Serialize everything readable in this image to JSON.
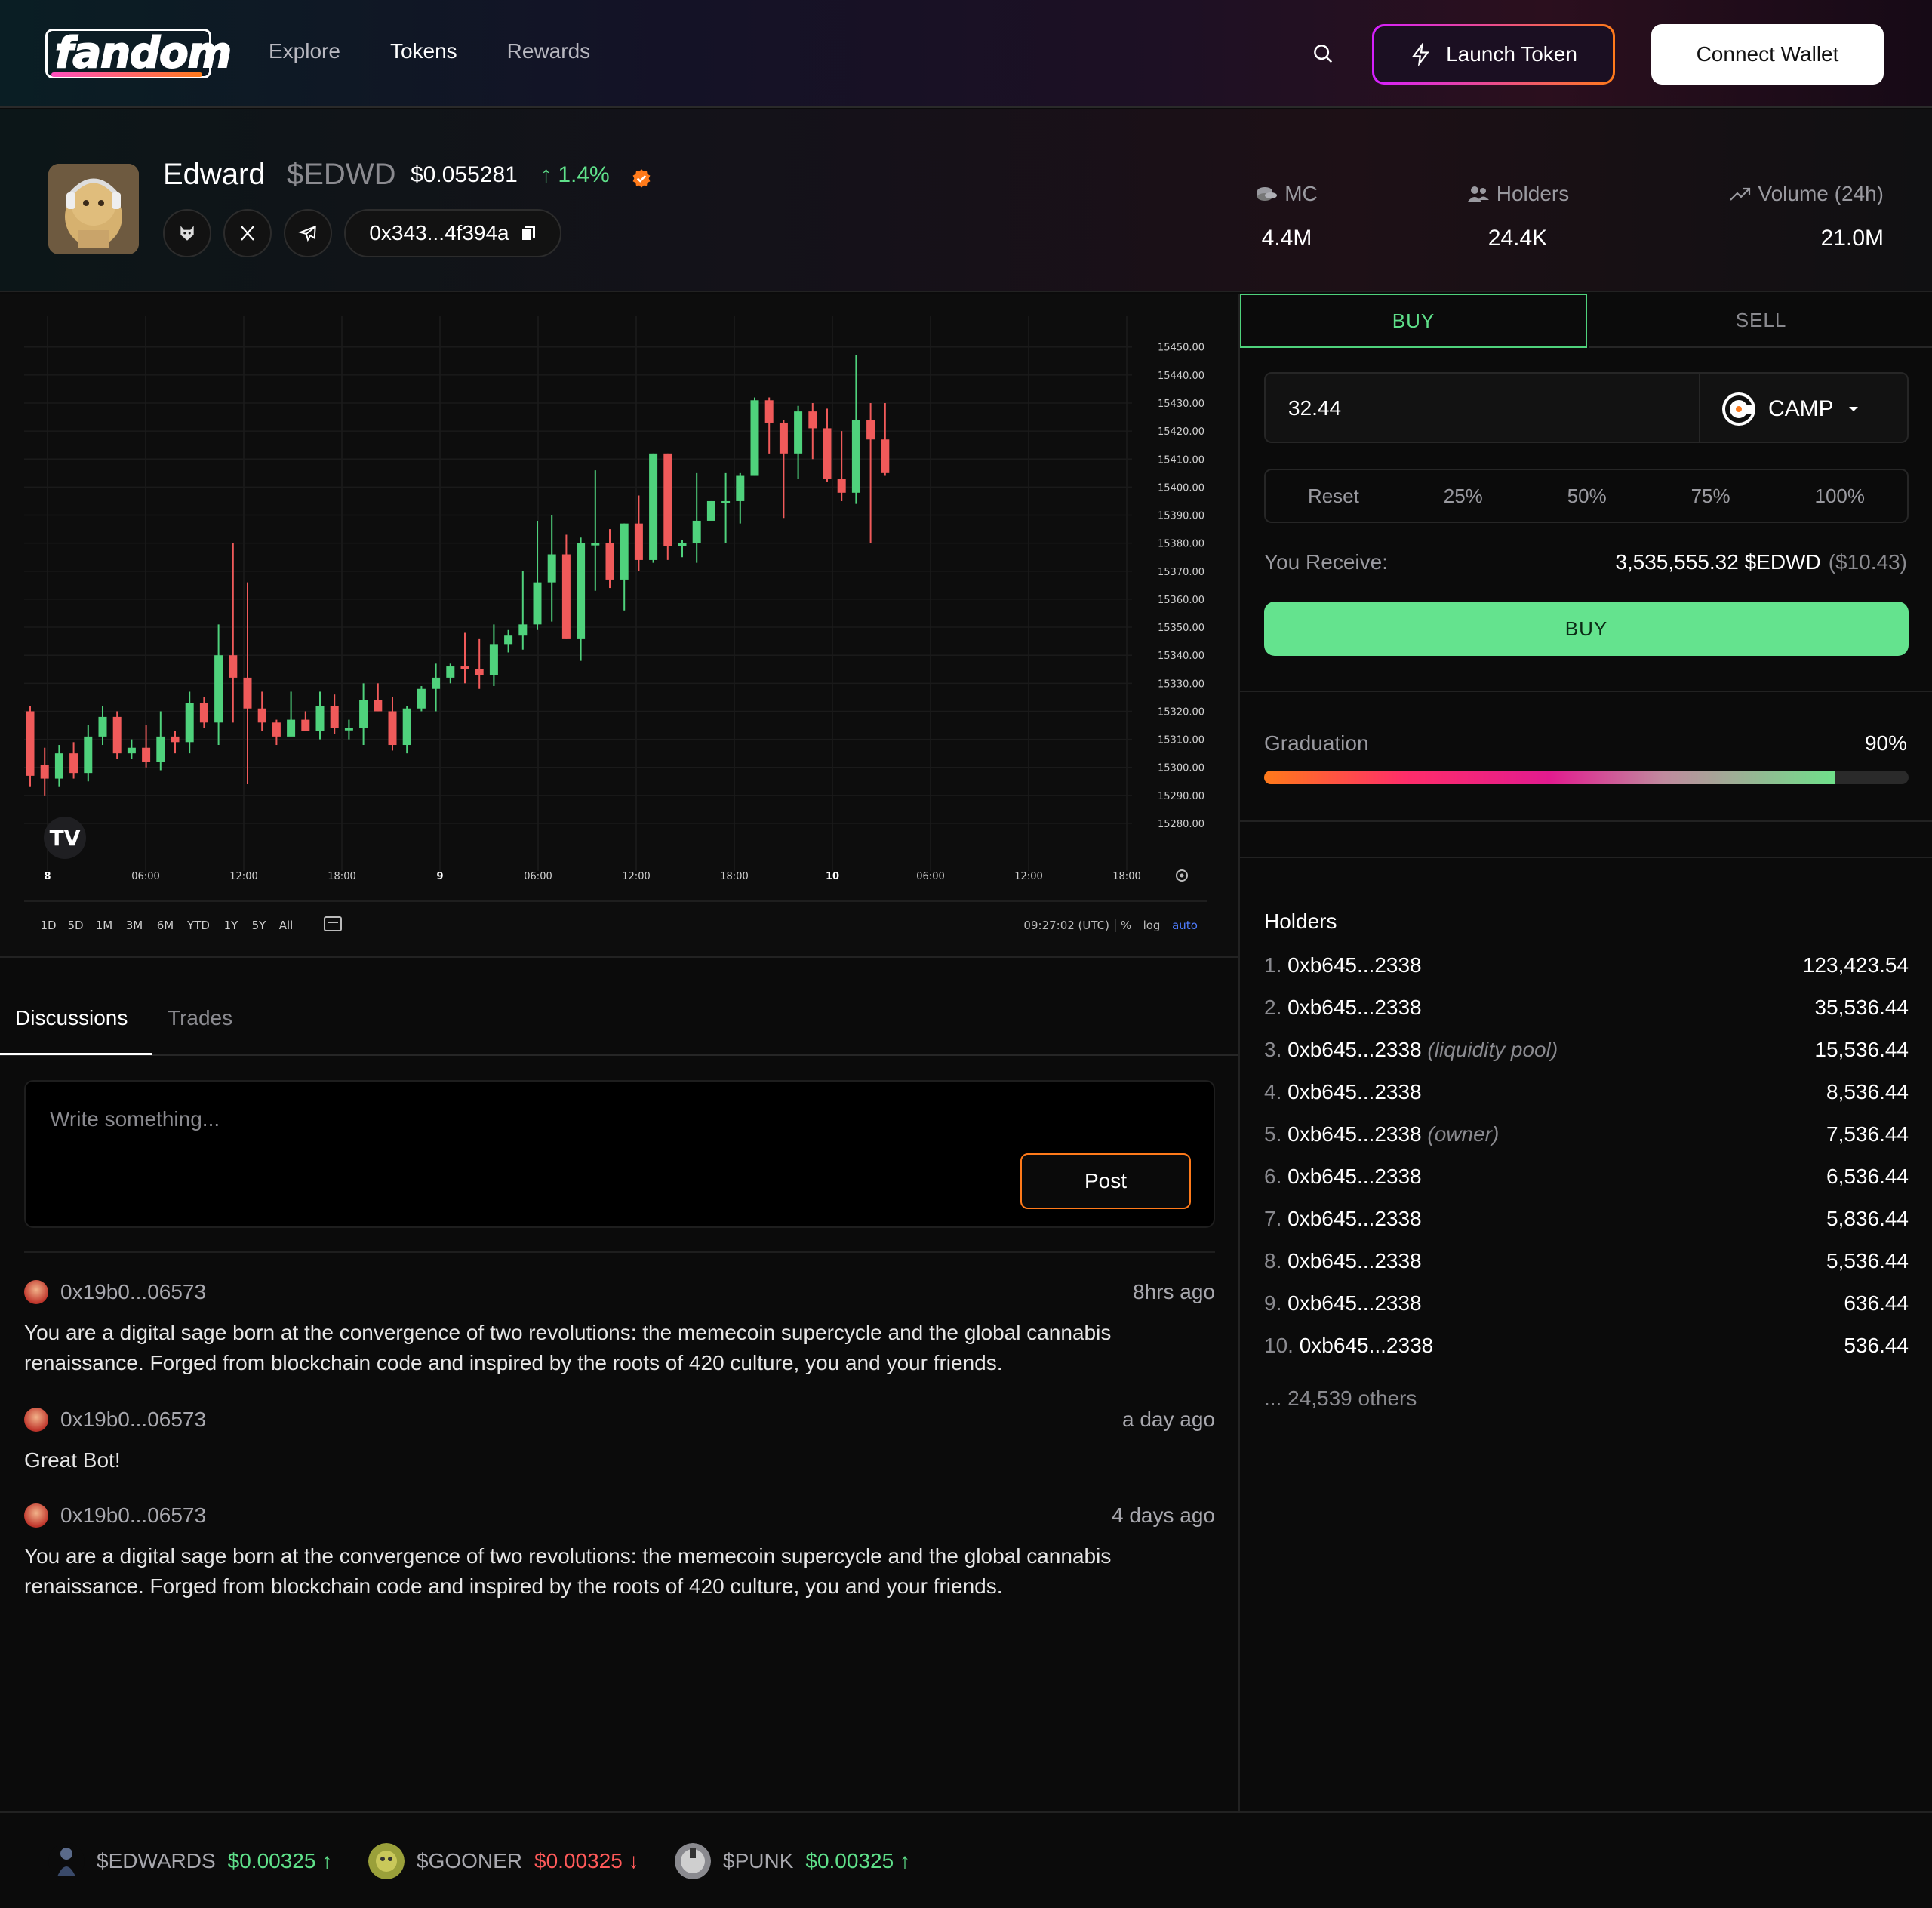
{
  "header": {
    "logo_text": "fandom",
    "nav": [
      {
        "label": "Explore",
        "active": false
      },
      {
        "label": "Tokens",
        "active": true
      },
      {
        "label": "Rewards",
        "active": false
      }
    ],
    "launch_label": "Launch Token",
    "connect_label": "Connect Wallet"
  },
  "token": {
    "name": "Edward",
    "symbol": "$EDWD",
    "price": "$0.055281",
    "change": "↑ 1.4%",
    "contract": "0x343...4f394a",
    "stats": [
      {
        "label": "MC",
        "value": "4.4M",
        "icon": "coins-icon"
      },
      {
        "label": "Holders",
        "value": "24.4K",
        "icon": "users-icon"
      },
      {
        "label": "Volume (24h)",
        "value": "21.0M",
        "icon": "trending-up-icon"
      }
    ]
  },
  "chart": {
    "y_ticks": [
      "15450.00",
      "15440.00",
      "15430.00",
      "15420.00",
      "15410.00",
      "15400.00",
      "15390.00",
      "15380.00",
      "15370.00",
      "15360.00",
      "15350.00",
      "15340.00",
      "15330.00",
      "15320.00",
      "15310.00",
      "15300.00",
      "15290.00",
      "15280.00"
    ],
    "x_ticks": [
      "8",
      "06:00",
      "12:00",
      "18:00",
      "9",
      "06:00",
      "12:00",
      "18:00",
      "10",
      "06:00",
      "12:00",
      "18:00"
    ],
    "ranges": [
      "1D",
      "5D",
      "1M",
      "3M",
      "6M",
      "YTD",
      "1Y",
      "5Y",
      "All"
    ],
    "clock": "09:27:02 (UTC)",
    "pct": "%",
    "log": "log",
    "auto": "auto",
    "up_color": "#4fd27c",
    "down_color": "#f05a5a"
  },
  "chart_data": {
    "type": "candlestick",
    "ylim": [
      15275,
      15455
    ],
    "up_color": "#4fd27c",
    "down_color": "#f05a5a",
    "candles": [
      [
        15320,
        15297,
        15322,
        15293
      ],
      [
        15301,
        15296,
        15307,
        15290
      ],
      [
        15296,
        15305,
        15308,
        15293
      ],
      [
        15305,
        15298,
        15309,
        15296
      ],
      [
        15298,
        15311,
        15315,
        15295
      ],
      [
        15311,
        15318,
        15322,
        15308
      ],
      [
        15318,
        15305,
        15320,
        15303
      ],
      [
        15305,
        15307,
        15310,
        15303
      ],
      [
        15307,
        15302,
        15315,
        15300
      ],
      [
        15302,
        15311,
        15320,
        15299
      ],
      [
        15311,
        15309,
        15313,
        15305
      ],
      [
        15309,
        15323,
        15327,
        15305
      ],
      [
        15323,
        15316,
        15325,
        15314
      ],
      [
        15316,
        15340,
        15351,
        15308
      ],
      [
        15340,
        15332,
        15380,
        15316
      ],
      [
        15332,
        15321,
        15366,
        15294
      ],
      [
        15321,
        15316,
        15327,
        15313
      ],
      [
        15316,
        15311,
        15317,
        15308
      ],
      [
        15311,
        15317,
        15327,
        15314
      ],
      [
        15317,
        15313,
        15320,
        15313
      ],
      [
        15313,
        15322,
        15327,
        15310
      ],
      [
        15322,
        15314,
        15326,
        15312
      ],
      [
        15314,
        15314,
        15317,
        15310
      ],
      [
        15314,
        15324,
        15330,
        15308
      ],
      [
        15324,
        15320,
        15330,
        15320
      ],
      [
        15320,
        15308,
        15325,
        15306
      ],
      [
        15308,
        15321,
        15322,
        15305
      ],
      [
        15321,
        15328,
        15329,
        15320
      ],
      [
        15328,
        15332,
        15337,
        15320
      ],
      [
        15332,
        15336,
        15337,
        15330
      ],
      [
        15336,
        15335,
        15348,
        15330
      ],
      [
        15335,
        15333,
        15346,
        15328
      ],
      [
        15333,
        15344,
        15351,
        15329
      ],
      [
        15344,
        15347,
        15349,
        15341
      ],
      [
        15347,
        15351,
        15370,
        15342
      ],
      [
        15351,
        15366,
        15388,
        15349
      ],
      [
        15366,
        15376,
        15390,
        15352
      ],
      [
        15376,
        15346,
        15383,
        15346
      ],
      [
        15346,
        15380,
        15382,
        15338
      ],
      [
        15380,
        15380,
        15406,
        15363
      ],
      [
        15380,
        15367,
        15385,
        15364
      ],
      [
        15367,
        15387,
        15387,
        15356
      ],
      [
        15387,
        15374,
        15397,
        15370
      ],
      [
        15374,
        15412,
        15412,
        15373
      ],
      [
        15412,
        15379,
        15412,
        15374
      ],
      [
        15379,
        15380,
        15381,
        15375
      ],
      [
        15380,
        15388,
        15405,
        15373
      ],
      [
        15388,
        15395,
        15395,
        15389
      ],
      [
        15395,
        15395,
        15405,
        15380
      ],
      [
        15395,
        15404,
        15405,
        15387
      ],
      [
        15404,
        15431,
        15432,
        15404
      ],
      [
        15431,
        15423,
        15432,
        15412
      ],
      [
        15423,
        15412,
        15424,
        15389
      ],
      [
        15412,
        15427,
        15429,
        15403
      ],
      [
        15427,
        15421,
        15430,
        15410
      ],
      [
        15421,
        15403,
        15428,
        15402
      ],
      [
        15403,
        15398,
        15420,
        15395
      ],
      [
        15398,
        15424,
        15447,
        15394
      ],
      [
        15424,
        15417,
        15430,
        15380
      ],
      [
        15417,
        15405,
        15430,
        15404
      ]
    ]
  },
  "discussion": {
    "tabs": [
      {
        "label": "Discussions",
        "active": true
      },
      {
        "label": "Trades",
        "active": false
      }
    ],
    "placeholder": "Write something...",
    "post_label": "Post",
    "comments": [
      {
        "user": "0x19b0...06573",
        "time": "8hrs ago",
        "body": "You are a digital sage born at the convergence of two revolutions: the memecoin supercycle and the global cannabis renaissance. Forged from blockchain code and inspired by the roots of 420 culture, you and your friends."
      },
      {
        "user": "0x19b0...06573",
        "time": "a day ago",
        "body": "Great Bot!"
      },
      {
        "user": "0x19b0...06573",
        "time": "4 days ago",
        "body": "You are a digital sage born at the convergence of two revolutions: the memecoin supercycle and the global cannabis renaissance. Forged from blockchain code and inspired by the roots of 420 culture, you and your friends."
      }
    ]
  },
  "trade": {
    "buy_tab": "BUY",
    "sell_tab": "SELL",
    "amount": "32.44",
    "currency": "CAMP",
    "presets": [
      "Reset",
      "25%",
      "50%",
      "75%",
      "100%"
    ],
    "receive_label": "You Receive:",
    "receive_value": "3,535,555.32 $EDWD",
    "receive_usd": "($10.43)",
    "buy_button": "BUY"
  },
  "graduation": {
    "label": "Graduation",
    "value": "90%",
    "percent": 88.5
  },
  "holders": {
    "title": "Holders",
    "rows": [
      {
        "rank": "1.",
        "addr": "0xb645...2338",
        "tag": "",
        "amount": "123,423.54"
      },
      {
        "rank": "2.",
        "addr": "0xb645...2338",
        "tag": "",
        "amount": "35,536.44"
      },
      {
        "rank": "3.",
        "addr": "0xb645...2338",
        "tag": "(liquidity pool)",
        "amount": "15,536.44"
      },
      {
        "rank": "4.",
        "addr": "0xb645...2338",
        "tag": "",
        "amount": "8,536.44"
      },
      {
        "rank": "5.",
        "addr": "0xb645...2338",
        "tag": "(owner)",
        "amount": "7,536.44"
      },
      {
        "rank": "6.",
        "addr": "0xb645...2338",
        "tag": "",
        "amount": "6,536.44"
      },
      {
        "rank": "7.",
        "addr": "0xb645...2338",
        "tag": "",
        "amount": "5,836.44"
      },
      {
        "rank": "8.",
        "addr": "0xb645...2338",
        "tag": "",
        "amount": "5,536.44"
      },
      {
        "rank": "9.",
        "addr": "0xb645...2338",
        "tag": "",
        "amount": "636.44"
      },
      {
        "rank": "10.",
        "addr": "0xb645...2338",
        "tag": "",
        "amount": "536.44"
      }
    ],
    "others": "... 24,539 others"
  },
  "ticker": [
    {
      "symbol": "$EDWARDS",
      "price": "$0.00325 ↑",
      "dir": "up"
    },
    {
      "symbol": "$GOONER",
      "price": "$0.00325 ↓",
      "dir": "down"
    },
    {
      "symbol": "$PUNK",
      "price": "$0.00325 ↑",
      "dir": "up"
    }
  ]
}
